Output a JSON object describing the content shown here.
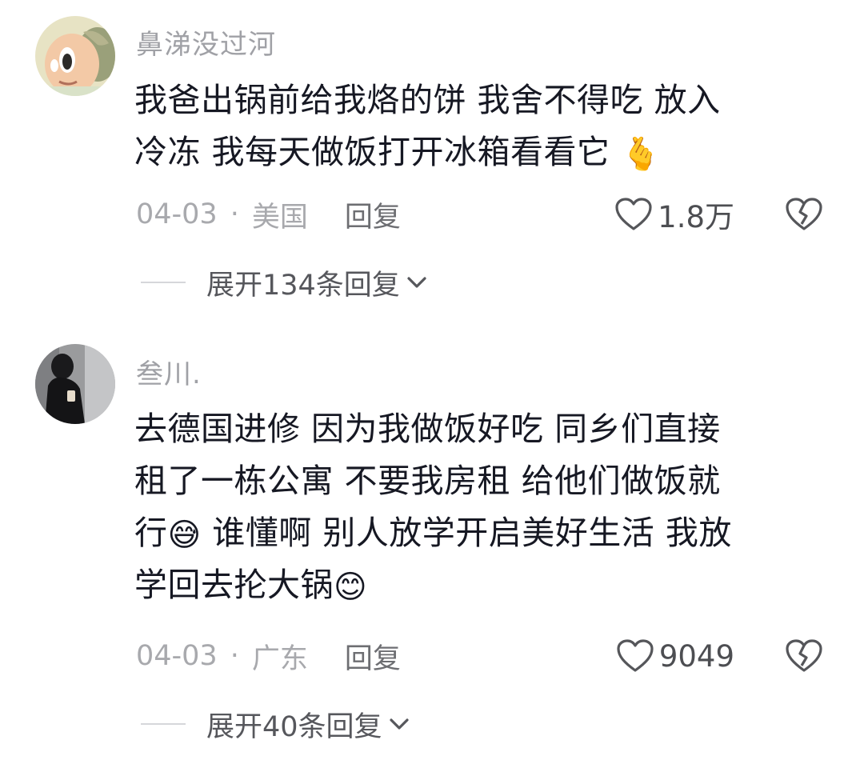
{
  "comments": [
    {
      "username": "鼻涕没过河",
      "lines": [
        "我爸出锅前给我烙的饼 我舍不得吃 放入",
        "冷冻 我每天做饭打开冰箱看看它"
      ],
      "line_emojis": [
        "",
        "🫰"
      ],
      "date": "04-03",
      "separator": "·",
      "location": "美国",
      "reply_label": "回复",
      "likes": "1.8万",
      "expand_label": "展开134条回复"
    },
    {
      "username": "叁川.",
      "lines": [
        "去德国进修 因为我做饭好吃 同乡们直接",
        "租了一栋公寓 不要我房租 给他们做饭就",
        "行",
        "谁懂啊 别人放学开启美好生活 我放",
        "学回去抡大锅"
      ],
      "line_emojis": [
        "",
        "",
        "😅",
        "",
        "😊"
      ],
      "date": "04-03",
      "separator": "·",
      "location": "广东",
      "reply_label": "回复",
      "likes": "9049",
      "expand_label": "展开40条回复"
    }
  ],
  "icons": {
    "like": "heart-outline-icon",
    "dislike": "broken-heart-icon",
    "expand": "chevron-down-icon"
  },
  "colors": {
    "text": "#161823",
    "muted": "#a8a9ad",
    "username": "#a0a1a6"
  }
}
